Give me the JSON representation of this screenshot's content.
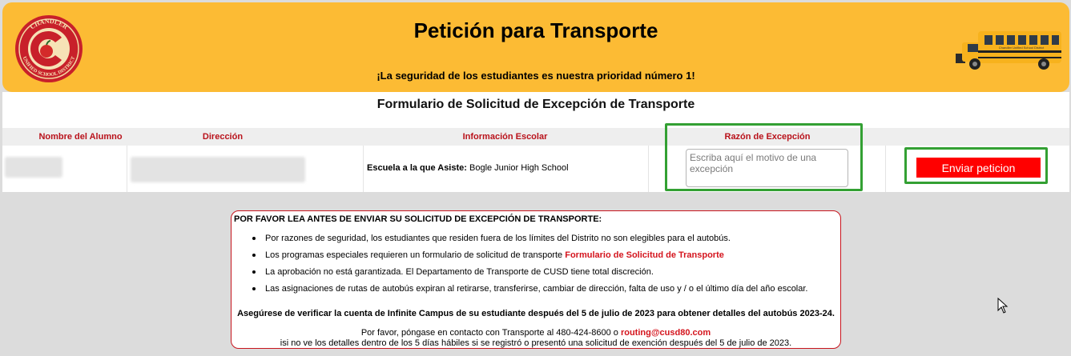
{
  "header": {
    "title": "Petición para Transporte",
    "tagline": "¡La seguridad de los estudiantes es nuestra prioridad número 1!",
    "logo_text_top": "CHANDLER",
    "logo_text_bottom": "UNIFIED SCHOOL DISTRICT",
    "bus_text": "Chandler Unified School District",
    "colors": {
      "banner": "#fcbb34",
      "logo_red": "#c8202a"
    }
  },
  "form": {
    "title": "Formulario de Solicitud de Excepción de Transporte",
    "columns": [
      "Nombre del Alumno",
      "Dirección",
      "Información Escolar",
      "Razón de Excepción"
    ],
    "school_label": "Escuela a la que Asiste:",
    "school_value": " Bogle Junior High School",
    "reason_placeholder": "Escriba aquí el motivo de una excepción",
    "submit_label": "Enviar peticion"
  },
  "notice": {
    "heading": "POR FAVOR LEA ANTES DE ENVIAR SU SOLICITUD DE EXCEPCIÓN DE TRANSPORTE:",
    "items": [
      "Por razones de seguridad, los estudiantes que residen fuera de los límites del Distrito no son elegibles para el autobús.",
      "Los programas especiales requieren un formulario de solicitud de transporte ",
      "La aprobación no está garantizada. El Departamento de Transporte de CUSD tiene total discreción.",
      "Las asignaciones de rutas de autobús expiran al retirarse, transferirse, cambiar de dirección, falta de uso y / o el último día del año escolar."
    ],
    "special_form_link": "Formulario de Solicitud de Transporte",
    "bold_line": "Asegúrese de verificar la cuenta de Infinite Campus de su estudiante después del 5 de julio de 2023 para obtener detalles del autobús 2023-24.",
    "contact_prefix": "Por favor, póngase en contacto con Transporte al 480-424-8600 o ",
    "email": "routing@cusd80.com",
    "contact_line2": "isi no ve los detalles dentro de los 5 días hábiles si se registró o presentó una solicitud de exención después del 5 de julio de 2023."
  }
}
